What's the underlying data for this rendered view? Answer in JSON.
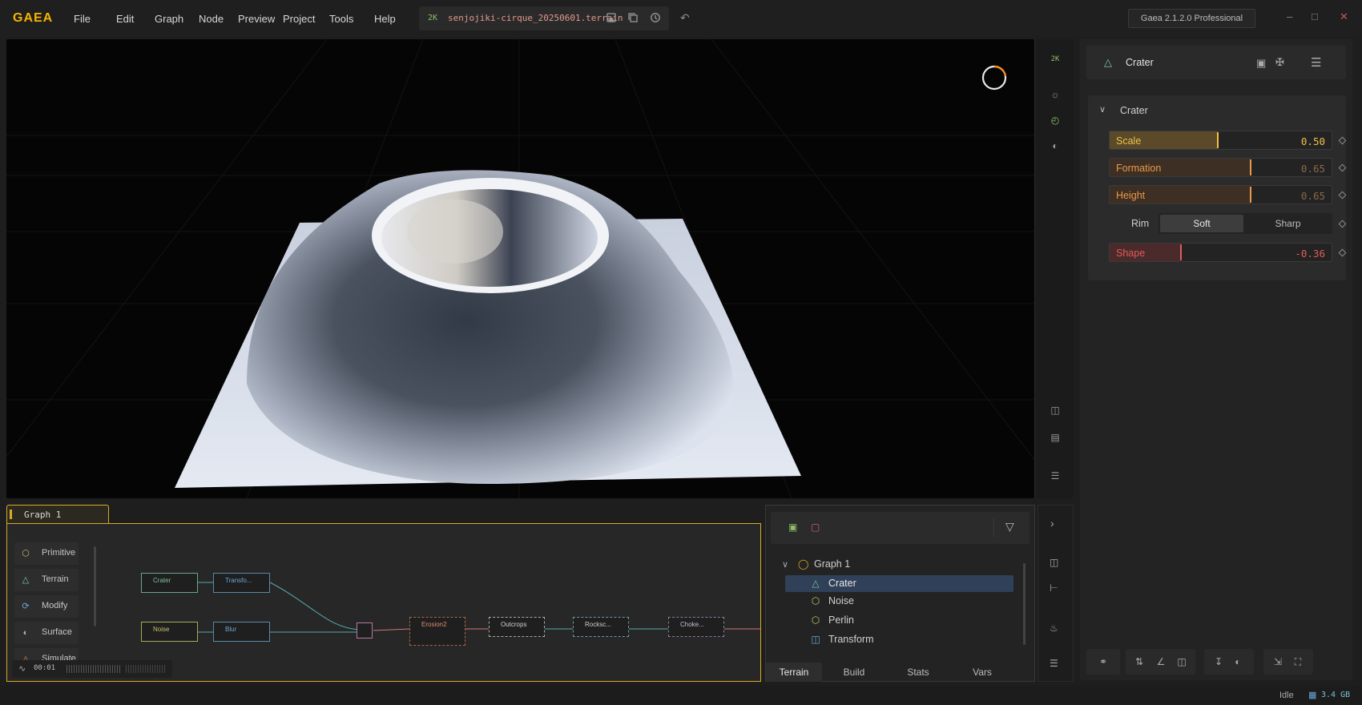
{
  "app": {
    "logo": "GAEA",
    "filename": "senjojiki-cirque_20250601.terrain",
    "resolution": "2K",
    "version": "Gaea 2.1.2.0 Professional"
  },
  "menu": [
    "File",
    "Edit",
    "Graph",
    "Node",
    "Preview",
    "Project",
    "Tools",
    "Help"
  ],
  "viewport": {
    "resolution_badge": "2K"
  },
  "node": {
    "title": "Crater",
    "section": "Crater",
    "props": {
      "scale": {
        "label": "Scale",
        "value": "0.50"
      },
      "formation": {
        "label": "Formation",
        "value": "0.65"
      },
      "height": {
        "label": "Height",
        "value": "0.65"
      },
      "rim": {
        "label": "Rim",
        "options": [
          "Soft",
          "Sharp"
        ],
        "selected": "Soft"
      },
      "shape": {
        "label": "Shape",
        "value": "-0.36"
      }
    }
  },
  "graph": {
    "tab": "Graph 1",
    "categories": [
      "Primitive",
      "Terrain",
      "Modify",
      "Surface",
      "Simulate"
    ],
    "nodes": [
      "Crater",
      "Transfo...",
      "Noise",
      "Blur",
      "Erosion2",
      "Outcrops",
      "Rocksc...",
      "Choke..."
    ],
    "timer": "00:01"
  },
  "tree": {
    "root": "Graph 1",
    "items": [
      "Crater",
      "Noise",
      "Perlin",
      "Transform"
    ],
    "selected": "Crater",
    "tabs": [
      "Terrain",
      "Build",
      "Stats",
      "Vars"
    ],
    "active_tab": "Terrain"
  },
  "status": {
    "state": "Idle",
    "memory": "3.4 GB"
  },
  "colors": {
    "accent": "#f5b400",
    "scale": "#f0c04a",
    "formation": "#e89a4a",
    "shape": "#e05c5c",
    "selected": "#2f4058"
  }
}
